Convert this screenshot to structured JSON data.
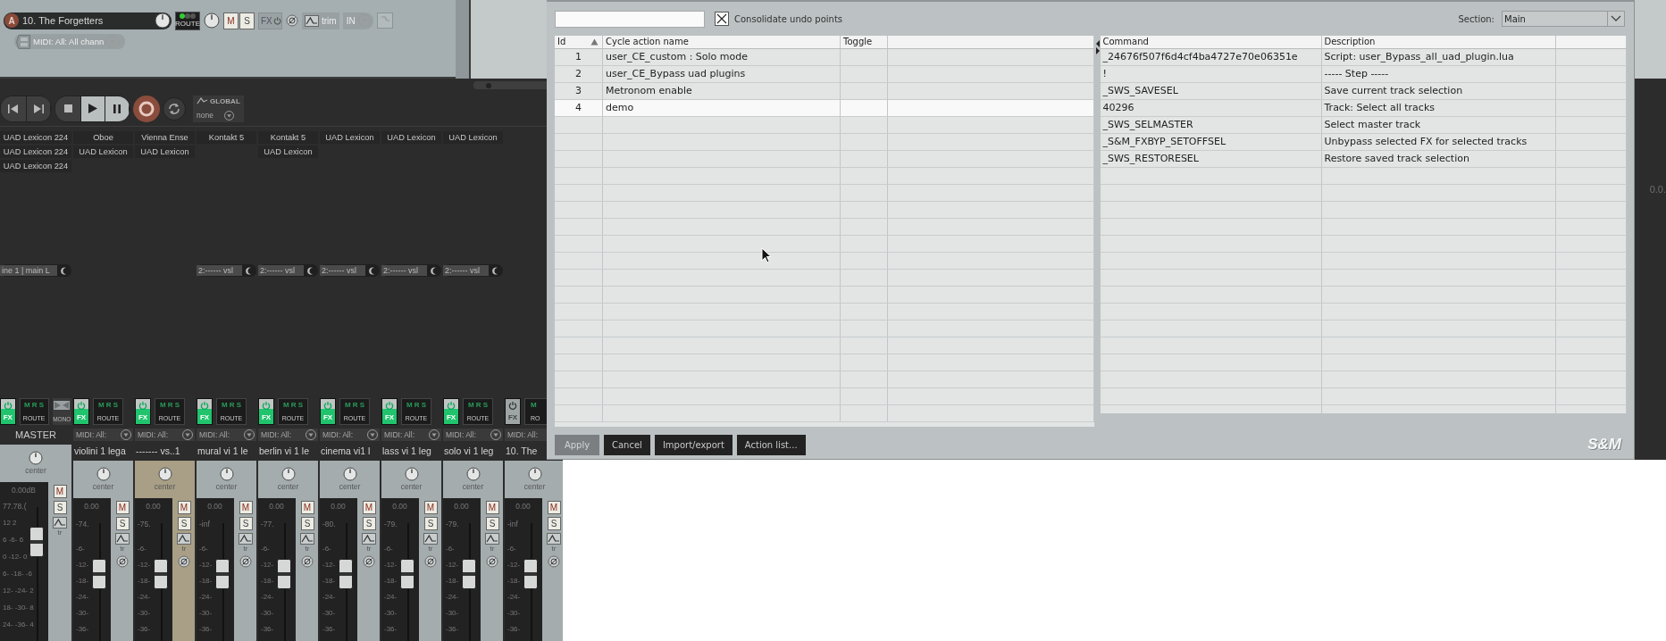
{
  "track": {
    "badge": "A",
    "name": "10. The Forgetters",
    "route": "ROUTE",
    "mute": "M",
    "solo": "S",
    "fx": "FX",
    "trim": "trim",
    "input": "IN",
    "midi_input": "MIDI: All: All chann"
  },
  "transport": {
    "automation_label": "GLOBAL",
    "automation_mode": "none"
  },
  "fx_columns": [
    {
      "slots": [
        "UAD Lexicon 224",
        "UAD Lexicon 224",
        "UAD Lexicon 224"
      ],
      "input": "ine 1 | main L"
    },
    {
      "slots": [
        "Oboe",
        "UAD Lexicon"
      ]
    },
    {
      "slots": [
        "Vienna Ense",
        "UAD Lexicon"
      ]
    },
    {
      "slots": [
        "Kontakt 5"
      ],
      "input": "2:------ vsl"
    },
    {
      "slots": [
        "Kontakt 5",
        "UAD Lexicon"
      ],
      "input": "2:------ vsl"
    },
    {
      "slots": [
        "UAD Lexicon"
      ],
      "input": "2:------ vsl"
    },
    {
      "slots": [
        "UAD Lexicon"
      ],
      "input": "2:------ vsl"
    },
    {
      "slots": [
        "UAD Lexicon"
      ],
      "input": "2:------ vsl"
    }
  ],
  "master": {
    "fx": "FX",
    "route_flags": "M R S",
    "route": "ROUTE",
    "mono": "MONO",
    "label": "MASTER",
    "pan": "center",
    "volume": "0.00dB",
    "peaks": "77.78.(",
    "scale": [
      "12  2",
      "6 -6- 6",
      "0 -12- 0",
      "6- -18- -6",
      "12- -24- 2",
      "18- -30- 8",
      "24- -36- 4"
    ],
    "mute": "M",
    "solo": "S",
    "env": "tr"
  },
  "channels": [
    {
      "fx": "FX",
      "fx_on": true,
      "route_flags": "M R S",
      "route": "ROUTE",
      "midi": "MIDI: All:",
      "name": "violini 1 lega",
      "selected": false,
      "pan": "center",
      "volume": "0.00",
      "peak": "-74.",
      "scale": [
        "-6-",
        "-12-",
        "-18-",
        "-24-",
        "-30-",
        "-36-"
      ],
      "mute": "M",
      "solo": "S",
      "env": "tr"
    },
    {
      "fx": "FX",
      "fx_on": true,
      "route_flags": "M R S",
      "route": "ROUTE",
      "midi": "MIDI: All:",
      "name": "------- vs..1",
      "selected": true,
      "pan": "center",
      "volume": "0.00",
      "peak": "-75.",
      "scale": [
        "-6-",
        "-12-",
        "-18-",
        "-24-",
        "-30-",
        "-36-"
      ],
      "mute": "M",
      "solo": "S",
      "env": "tr"
    },
    {
      "fx": "FX",
      "fx_on": true,
      "route_flags": "M R S",
      "route": "ROUTE",
      "midi": "MIDI: All:",
      "name": "mural vi 1 le",
      "selected": false,
      "pan": "center",
      "volume": "0.00",
      "peak": "-inf",
      "scale": [
        "-6-",
        "-12-",
        "-18-",
        "-24-",
        "-30-",
        "-36-"
      ],
      "mute": "M",
      "solo": "S",
      "env": "tr"
    },
    {
      "fx": "FX",
      "fx_on": true,
      "route_flags": "M R S",
      "route": "ROUTE",
      "midi": "MIDI: All:",
      "name": "berlin vi 1 le",
      "selected": false,
      "pan": "center",
      "volume": "0.00",
      "peak": "-77.",
      "scale": [
        "-6-",
        "-12-",
        "-18-",
        "-24-",
        "-30-",
        "-36-"
      ],
      "mute": "M",
      "solo": "S",
      "env": "tr"
    },
    {
      "fx": "FX",
      "fx_on": true,
      "route_flags": "M R S",
      "route": "ROUTE",
      "midi": "MIDI: All:",
      "name": "cinema vi1 l",
      "selected": false,
      "pan": "center",
      "volume": "0.00",
      "peak": "-80.",
      "scale": [
        "-6-",
        "-12-",
        "-18-",
        "-24-",
        "-30-",
        "-36-"
      ],
      "mute": "M",
      "solo": "S",
      "env": "tr"
    },
    {
      "fx": "FX",
      "fx_on": true,
      "route_flags": "M R S",
      "route": "ROUTE",
      "midi": "MIDI: All:",
      "name": "lass vi 1 leg",
      "selected": false,
      "pan": "center",
      "volume": "0.00",
      "peak": "-79.",
      "scale": [
        "-6-",
        "-12-",
        "-18-",
        "-24-",
        "-30-",
        "-36-"
      ],
      "mute": "M",
      "solo": "S",
      "env": "tr"
    },
    {
      "fx": "FX",
      "fx_on": true,
      "route_flags": "M R S",
      "route": "ROUTE",
      "midi": "MIDI: All:",
      "name": "solo vi 1 leg",
      "selected": false,
      "pan": "center",
      "volume": "0.00",
      "peak": "-79.",
      "scale": [
        "-6-",
        "-12-",
        "-18-",
        "-24-",
        "-30-",
        "-36-"
      ],
      "mute": "M",
      "solo": "S",
      "env": "tr"
    },
    {
      "fx": "FX",
      "fx_on": false,
      "route_flags": "M",
      "route": "RO",
      "midi": "MIDI: All:",
      "name": "10. The",
      "selected": false,
      "pan": "center",
      "volume": "0.00",
      "peak": "-inf",
      "scale": [
        "-6-",
        "-12-",
        "-18-",
        "-24-",
        "-30-",
        "-36-"
      ],
      "mute": "M",
      "solo": "S",
      "env": "tr"
    }
  ],
  "window_edge_text": "0.0.",
  "dialog": {
    "consolidate": {
      "label": "Consolidate undo points",
      "checked": true
    },
    "section": {
      "label": "Section:",
      "value": "Main"
    },
    "actions_table": {
      "columns": [
        {
          "label": "Id",
          "sorted": true
        },
        {
          "label": "Cycle action name",
          "sorted": false
        },
        {
          "label": "Toggle",
          "sorted": false
        }
      ],
      "rows": [
        {
          "id": "1",
          "name": "user_CE_custom : Solo mode",
          "selected": false
        },
        {
          "id": "2",
          "name": "user_CE_Bypass uad plugins",
          "selected": false
        },
        {
          "id": "3",
          "name": "Metronom enable",
          "selected": false
        },
        {
          "id": "4",
          "name": "demo",
          "selected": true
        }
      ]
    },
    "commands_table": {
      "columns": [
        "Command",
        "Description"
      ],
      "rows": [
        {
          "command": "_24676f507f6d4cf4ba4727e70e06351e",
          "description": "Script: user_Bypass_all_uad_plugin.lua"
        },
        {
          "command": "!",
          "description": "----- Step -----"
        },
        {
          "command": "_SWS_SAVESEL",
          "description": "Save current track selection"
        },
        {
          "command": "40296",
          "description": "Track: Select all tracks"
        },
        {
          "command": "_SWS_SELMASTER",
          "description": "Select master track"
        },
        {
          "command": "_S&M_FXBYP_SETOFFSEL",
          "description": "Unbypass selected FX for selected tracks"
        },
        {
          "command": "_SWS_RESTORESEL",
          "description": "Restore saved track selection"
        }
      ]
    },
    "buttons": [
      {
        "label": "Apply",
        "disabled": true
      },
      {
        "label": "Cancel",
        "disabled": false
      },
      {
        "label": "Import/export",
        "disabled": false
      },
      {
        "label": "Action list...",
        "disabled": false
      }
    ],
    "logo": "S&M"
  }
}
